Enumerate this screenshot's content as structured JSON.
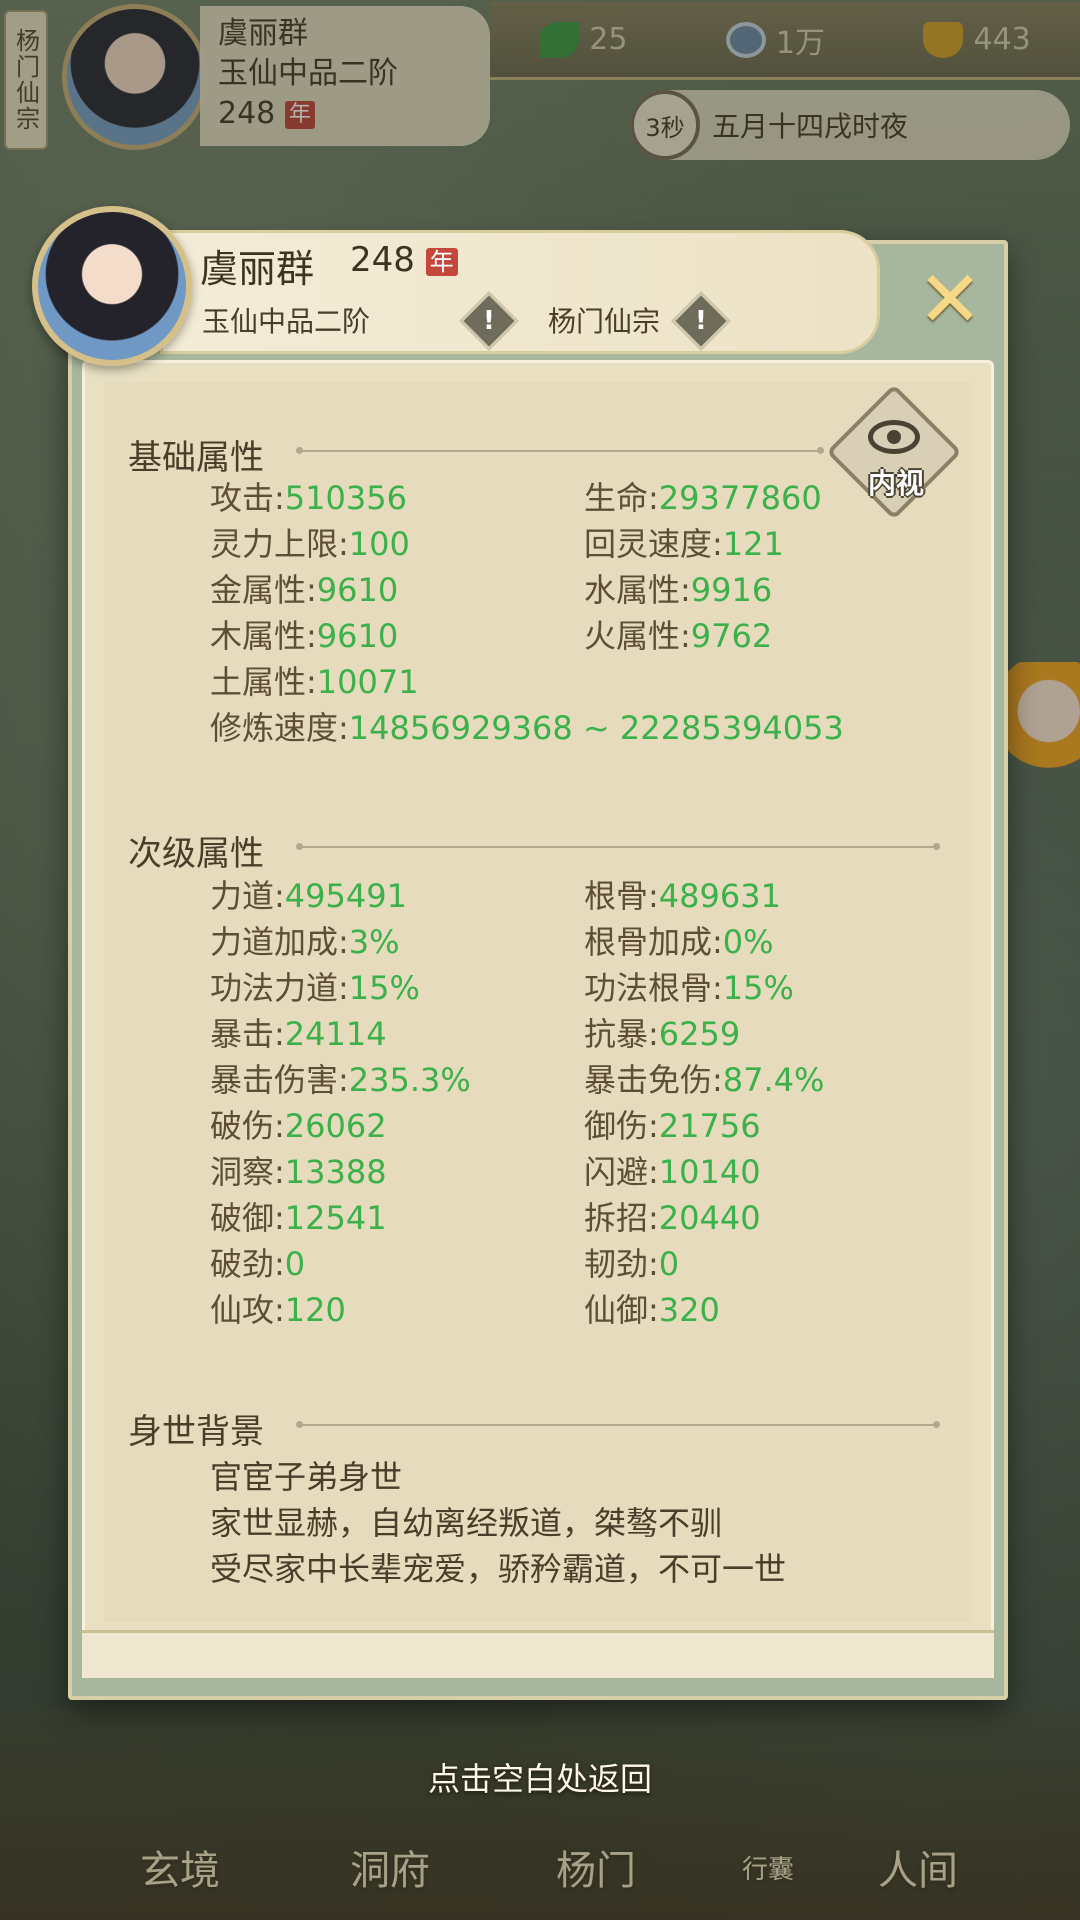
{
  "hud": {
    "sect_tag": "杨门仙宗",
    "player_name": "虞丽群",
    "realm": "玉仙中品二阶",
    "age": "248",
    "year_badge": "年",
    "resources": [
      {
        "icon": "jade-leaf-icon",
        "value": "25",
        "color": "#3f9a46"
      },
      {
        "icon": "coin-icon",
        "value": "1万",
        "color": "#6f8aa6"
      },
      {
        "icon": "gold-ingot-icon",
        "value": "443",
        "color": "#d4a22a"
      }
    ],
    "timer": "3秒",
    "date": "五月十四戌时夜"
  },
  "panel": {
    "name": "虞丽群",
    "age": "248",
    "year_badge": "年",
    "realm": "玉仙中品二阶",
    "sect": "杨门仙宗",
    "close_icon": "✕",
    "inspect_label": "内视",
    "basic": {
      "title": "基础属性",
      "stats": [
        {
          "k": "攻击:",
          "v": "510356"
        },
        {
          "k": "生命:",
          "v": "29377860"
        },
        {
          "k": "灵力上限:",
          "v": "100"
        },
        {
          "k": "回灵速度:",
          "v": "121"
        },
        {
          "k": "金属性:",
          "v": "9610"
        },
        {
          "k": "水属性:",
          "v": "9916"
        },
        {
          "k": "木属性:",
          "v": "9610"
        },
        {
          "k": "火属性:",
          "v": "9762"
        },
        {
          "k": "土属性:",
          "v": "10071"
        },
        {
          "k": "修炼速度:",
          "v": "14856929368 ~ 22285394053"
        }
      ]
    },
    "secondary": {
      "title": "次级属性",
      "stats": [
        {
          "k": "力道:",
          "v": "495491"
        },
        {
          "k": "根骨:",
          "v": "489631"
        },
        {
          "k": "力道加成:",
          "v": "3%"
        },
        {
          "k": "根骨加成:",
          "v": "0%"
        },
        {
          "k": "功法力道:",
          "v": "15%"
        },
        {
          "k": "功法根骨:",
          "v": "15%"
        },
        {
          "k": "暴击:",
          "v": "24114"
        },
        {
          "k": "抗暴:",
          "v": "6259"
        },
        {
          "k": "暴击伤害:",
          "v": "235.3%"
        },
        {
          "k": "暴击免伤:",
          "v": "87.4%"
        },
        {
          "k": "破伤:",
          "v": "26062"
        },
        {
          "k": "御伤:",
          "v": "21756"
        },
        {
          "k": "洞察:",
          "v": "13388"
        },
        {
          "k": "闪避:",
          "v": "10140"
        },
        {
          "k": "破御:",
          "v": "12541"
        },
        {
          "k": "拆招:",
          "v": "20440"
        },
        {
          "k": "破劲:",
          "v": "0"
        },
        {
          "k": "韧劲:",
          "v": "0"
        },
        {
          "k": "仙攻:",
          "v": "120"
        },
        {
          "k": "仙御:",
          "v": "320"
        }
      ]
    },
    "background": {
      "title": "身世背景",
      "lines": [
        "官宦子弟身世",
        "家世显赫，自幼离经叛道，桀骜不驯",
        "受尽家中长辈宠爱，骄矜霸道，不可一世"
      ]
    }
  },
  "back_hint": "点击空白处返回",
  "nav": {
    "xuanjing": "玄境",
    "dongfu": "洞府",
    "yangmen": "杨门",
    "bag": "行囊",
    "renjian": "人间"
  }
}
